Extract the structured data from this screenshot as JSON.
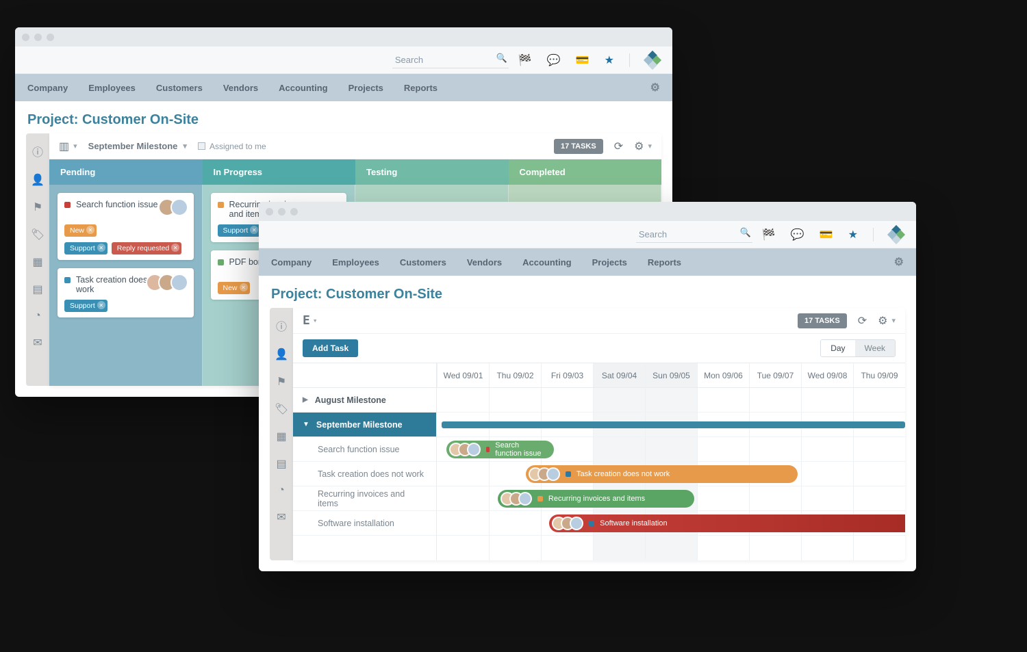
{
  "search_placeholder": "Search",
  "nav": {
    "company": "Company",
    "employees": "Employees",
    "customers": "Customers",
    "vendors": "Vendors",
    "accounting": "Accounting",
    "projects": "Projects",
    "reports": "Reports"
  },
  "page_title": "Project: Customer On-Site",
  "kanban": {
    "milestone": "September Milestone",
    "assigned_label": "Assigned to me",
    "taskcount": "17 TASKS",
    "columns": {
      "pending": "Pending",
      "in_progress": "In Progress",
      "testing": "Testing",
      "completed": "Completed"
    },
    "cards": {
      "c1_title": "Search function issue",
      "c2_title": "Task creation does not work",
      "c3_title": "Recurring invoices and items",
      "c4_title": "PDF border"
    },
    "chips": {
      "new": "New",
      "support": "Support",
      "reply": "Reply requested"
    }
  },
  "gantt": {
    "taskcount": "17 TASKS",
    "add_task": "Add Task",
    "day": "Day",
    "week": "Week",
    "days": {
      "d0": "Wed 09/01",
      "d1": "Thu 09/02",
      "d2": "Fri 09/03",
      "d3": "Sat 09/04",
      "d4": "Sun 09/05",
      "d5": "Mon 09/06",
      "d6": "Tue 09/07",
      "d7": "Wed 09/08",
      "d8": "Thu 09/09"
    },
    "groups": {
      "g1": "August Milestone",
      "g2": "September Milestone"
    },
    "tasks": {
      "t1": "Search function issue",
      "t2": "Task creation does not work",
      "t3": "Recurring invoices and items",
      "t4": "Software installation"
    },
    "bar_labels": {
      "b1": "Search function issue",
      "b2": "Task creation does not work",
      "b3": "Recurring invoices and items",
      "b4": "Software installation"
    }
  },
  "colors": {
    "red": "#c7403a",
    "orange": "#e79a49",
    "green": "#6aab6e",
    "blue": "#3a8fb4",
    "darkred": "#b7362f"
  }
}
